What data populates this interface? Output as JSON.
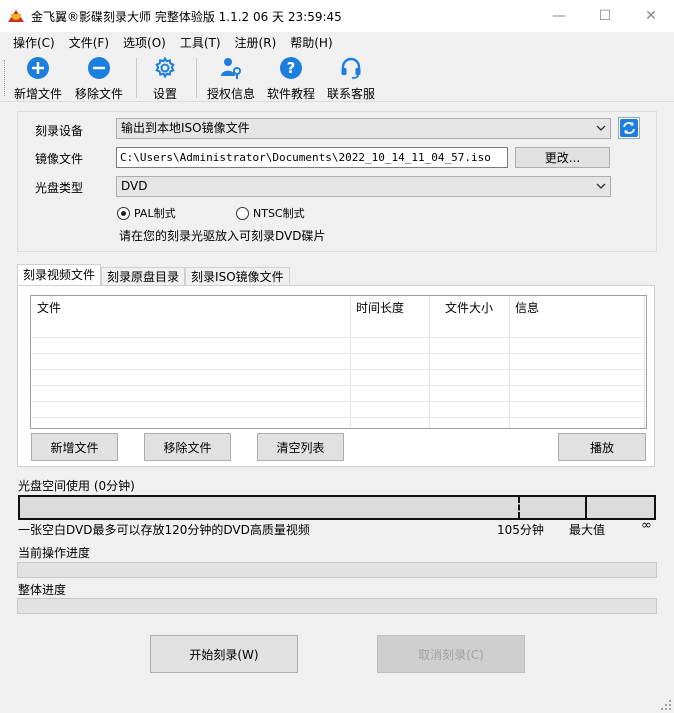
{
  "window": {
    "title": "金飞翼®影碟刻录大师 完整体验版 1.1.2 06 天 23:59:45",
    "minimize": "—",
    "maximize": "☐",
    "close": "✕"
  },
  "menu": [
    "操作(C)",
    "文件(F)",
    "选项(O)",
    "工具(T)",
    "注册(R)",
    "帮助(H)"
  ],
  "toolbar": {
    "add_file": "新增文件",
    "remove_file": "移除文件",
    "settings": "设置",
    "license": "授权信息",
    "tutorial": "软件教程",
    "contact": "联系客服",
    "icons": {
      "add_file": "plus-circle-icon",
      "remove_file": "minus-circle-icon",
      "settings": "gear-icon",
      "license": "key-user-icon",
      "tutorial": "question-icon",
      "contact": "headset-icon"
    },
    "accent": "#1c7fe0"
  },
  "burn": {
    "device_label": "刻录设备",
    "device_value": "输出到本地ISO镜像文件",
    "image_label": "镜像文件",
    "image_path": "C:\\Users\\Administrator\\Documents\\2022_10_14_11_04_57.iso",
    "change_button": "更改...",
    "disc_type_label": "光盘类型",
    "disc_type_value": "DVD",
    "pal": "PAL制式",
    "ntsc": "NTSC制式",
    "hint": "请在您的刻录光驱放入可刻录DVD碟片"
  },
  "tabs": [
    "刻录视频文件",
    "刻录原盘目录",
    "刻录ISO镜像文件"
  ],
  "file_table": {
    "columns": [
      "文件",
      "时间长度",
      "文件大小",
      "信息"
    ],
    "rows": []
  },
  "file_buttons": {
    "add": "新增文件",
    "remove": "移除文件",
    "clear": "清空列表",
    "play": "播放"
  },
  "disk": {
    "usage_label": "光盘空间使用 (0分钟)",
    "usage_minutes": 0,
    "capacity_note": "一张空白DVD最多可以存放120分钟的DVD高质量视频",
    "mark_105": "105分钟",
    "mark_max": "最大值",
    "mark_inf": "∞"
  },
  "progress": {
    "current_label": "当前操作进度",
    "current_value": 0,
    "overall_label": "整体进度",
    "overall_value": 0
  },
  "actions": {
    "start": "开始刻录(W)",
    "cancel": "取消刻录(C)"
  }
}
